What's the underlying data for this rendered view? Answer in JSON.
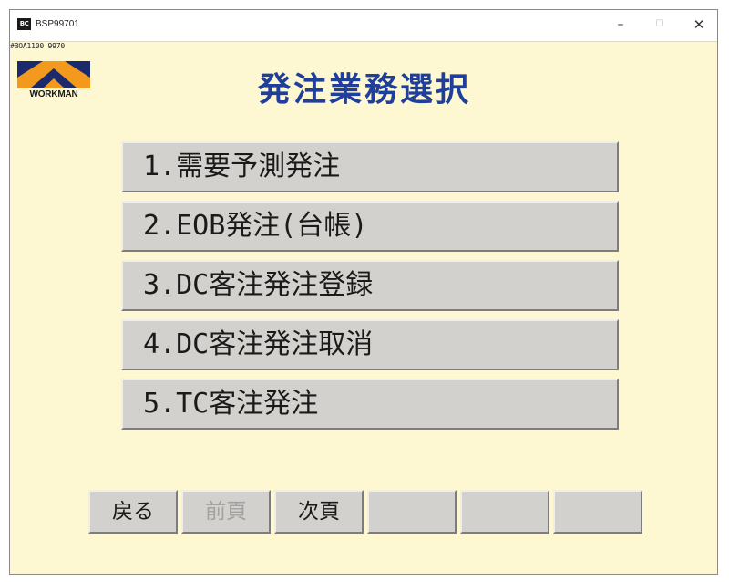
{
  "window": {
    "icon_text": "BC",
    "title": "BSP99701",
    "minimize_symbol": "–",
    "maximize_symbol": "☐",
    "close_symbol": "✕"
  },
  "screen_id": "#BOA1100 9970",
  "logo": {
    "text": "WORKMAN",
    "colors": {
      "orange": "#f39a1e",
      "navy": "#1a2a6c"
    }
  },
  "page_title": "発注業務選択",
  "colors": {
    "background": "#fdf8d2",
    "title": "#1f3f9a",
    "button": "#d3d1cd"
  },
  "menu": [
    {
      "label": "1.需要予測発注"
    },
    {
      "label": "2.EOB発注(台帳)"
    },
    {
      "label": "3.DC客注発注登録"
    },
    {
      "label": "4.DC客注発注取消"
    },
    {
      "label": "5.TC客注発注"
    }
  ],
  "function_keys": [
    {
      "label": "戻る",
      "enabled": true
    },
    {
      "label": "前頁",
      "enabled": false
    },
    {
      "label": "次頁",
      "enabled": true
    },
    {
      "label": "",
      "enabled": false
    },
    {
      "label": "",
      "enabled": false
    },
    {
      "label": "",
      "enabled": false
    }
  ]
}
